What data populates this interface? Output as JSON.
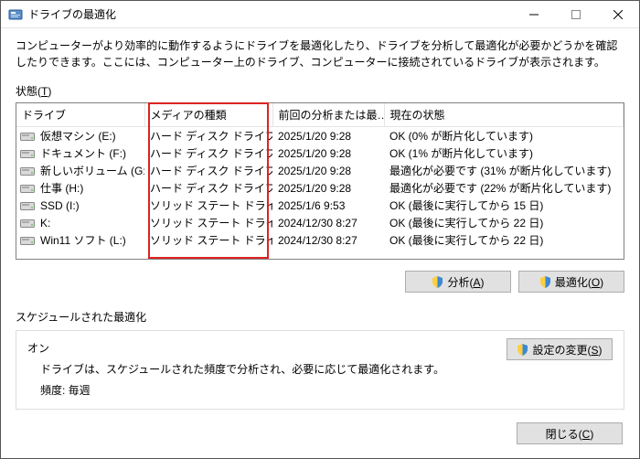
{
  "window": {
    "title": "ドライブの最適化"
  },
  "description": "コンピューターがより効率的に動作するようにドライブを最適化したり、ドライブを分析して最適化が必要かどうかを確認したりできます。ここには、コンピューター上のドライブ、コンピューターに接続されているドライブが表示されます。",
  "status_label": "状態",
  "status_label_key": "T",
  "columns": {
    "drive": "ドライブ",
    "media": "メディアの種類",
    "last": "前回の分析または最…",
    "current": "現在の状態"
  },
  "drives": [
    {
      "name": "仮想マシン (E:)",
      "media": "ハード ディスク ドライブ",
      "last": "2025/1/20 9:28",
      "status": "OK (0% が断片化しています)",
      "type": "hdd"
    },
    {
      "name": "ドキュメント (F:)",
      "media": "ハード ディスク ドライブ",
      "last": "2025/1/20 9:28",
      "status": "OK (1% が断片化しています)",
      "type": "hdd"
    },
    {
      "name": "新しいボリューム (G:)",
      "media": "ハード ディスク ドライブ",
      "last": "2025/1/20 9:28",
      "status": "最適化が必要です (31% が断片化しています)",
      "type": "hdd"
    },
    {
      "name": "仕事 (H:)",
      "media": "ハード ディスク ドライブ",
      "last": "2025/1/20 9:28",
      "status": "最適化が必要です (22% が断片化しています)",
      "type": "hdd"
    },
    {
      "name": "SSD (I:)",
      "media": "ソリッド ステート ドライブ",
      "last": "2025/1/6 9:53",
      "status": "OK (最後に実行してから 15 日)",
      "type": "ssd"
    },
    {
      "name": "K:",
      "media": "ソリッド ステート ドライブ",
      "last": "2024/12/30 8:27",
      "status": "OK (最後に実行してから 22 日)",
      "type": "ssd"
    },
    {
      "name": "Win11 ソフト (L:)",
      "media": "ソリッド ステート ドライブ",
      "last": "2024/12/30 8:27",
      "status": "OK (最後に実行してから 22 日)",
      "type": "ssd"
    }
  ],
  "buttons": {
    "analyze": "分析",
    "analyze_key": "A",
    "optimize": "最適化",
    "optimize_key": "O",
    "settings": "設定の変更",
    "settings_key": "S",
    "close": "閉じる",
    "close_key": "C"
  },
  "schedule": {
    "label": "スケジュールされた最適化",
    "on": "オン",
    "text": "ドライブは、スケジュールされた頻度で分析され、必要に応じて最適化されます。",
    "freq": "頻度: 毎週"
  }
}
